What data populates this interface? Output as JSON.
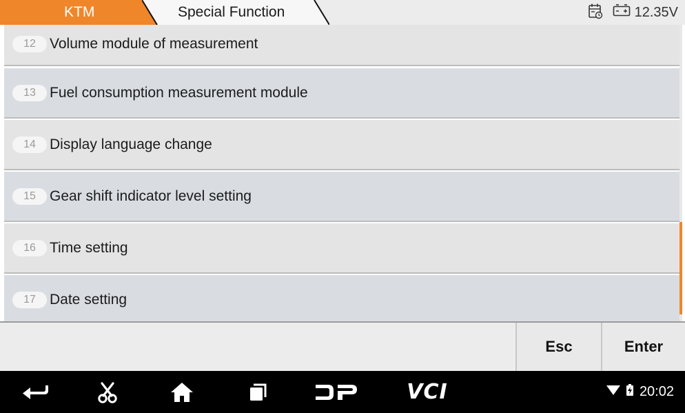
{
  "breadcrumb": {
    "root": "KTM",
    "current": "Special Function"
  },
  "status": {
    "calendar_icon": "calendar-clock-icon",
    "battery_icon": "battery-icon",
    "voltage": "12.35V"
  },
  "list": {
    "items": [
      {
        "index": "12",
        "label": "Volume module of measurement"
      },
      {
        "index": "13",
        "label": "Fuel consumption measurement module"
      },
      {
        "index": "14",
        "label": "Display language change"
      },
      {
        "index": "15",
        "label": "Gear shift indicator level setting"
      },
      {
        "index": "16",
        "label": "Time setting"
      },
      {
        "index": "17",
        "label": "Date setting"
      }
    ]
  },
  "actions": {
    "esc_label": "Esc",
    "enter_label": "Enter"
  },
  "navbar": {
    "back_icon": "back-arrow-icon",
    "scissors_icon": "scissors-icon",
    "home_icon": "home-icon",
    "recents_icon": "recent-apps-icon",
    "dp_icon": "dp-logo-icon",
    "vci_label": "VCI",
    "time": "20:02"
  },
  "colors": {
    "accent": "#f0862a",
    "list_bg": "#e4e4e4",
    "list_bg_alt": "#d9dde2",
    "navbar_bg": "#000000"
  }
}
